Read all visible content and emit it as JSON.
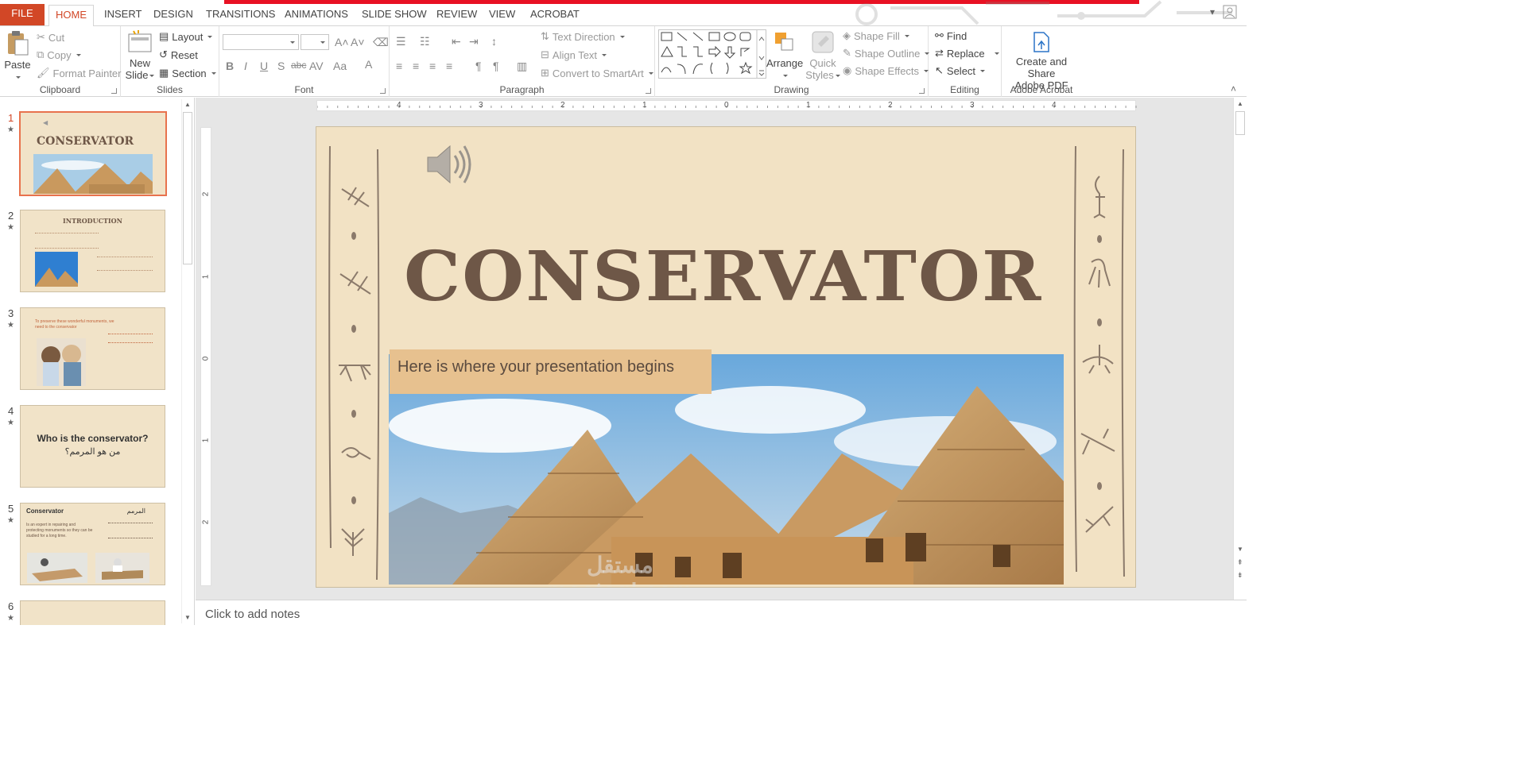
{
  "tabs": {
    "file": "FILE",
    "items": [
      "HOME",
      "INSERT",
      "DESIGN",
      "TRANSITIONS",
      "ANIMATIONS",
      "SLIDE SHOW",
      "REVIEW",
      "VIEW",
      "ACROBAT"
    ],
    "active": "HOME"
  },
  "ribbon": {
    "clipboard": {
      "label": "Clipboard",
      "paste": "Paste",
      "cut": "Cut",
      "copy": "Copy",
      "format_painter": "Format Painter"
    },
    "slides": {
      "label": "Slides",
      "new_slide_1": "New",
      "new_slide_2": "Slide",
      "layout": "Layout",
      "reset": "Reset",
      "section": "Section"
    },
    "font": {
      "label": "Font"
    },
    "paragraph": {
      "label": "Paragraph",
      "text_direction": "Text Direction",
      "align_text": "Align Text",
      "convert_smartart": "Convert to SmartArt"
    },
    "drawing": {
      "label": "Drawing",
      "arrange": "Arrange",
      "quick_styles_1": "Quick",
      "quick_styles_2": "Styles",
      "shape_fill": "Shape Fill",
      "shape_outline": "Shape Outline",
      "shape_effects": "Shape Effects"
    },
    "editing": {
      "label": "Editing",
      "find": "Find",
      "replace": "Replace",
      "select": "Select"
    },
    "acrobat": {
      "label": "Adobe Acrobat",
      "create_1": "Create and Share",
      "create_2": "Adobe PDF"
    }
  },
  "thumbnails": [
    {
      "num": "1",
      "title": "CONSERVATOR",
      "sub": "Here is where your presentation begins"
    },
    {
      "num": "2",
      "title": "INTRODUCTION"
    },
    {
      "num": "3",
      "title": "To preserve these wonderful monuments, we need to the conservator"
    },
    {
      "num": "4",
      "title": "Who is the conservator?",
      "arabic": "من هو المرمم؟"
    },
    {
      "num": "5",
      "title": "Conservator",
      "arabic": "المرمم",
      "body": "Is an expert in repairing and protecting monuments so they can be studied for a long time."
    },
    {
      "num": "6"
    }
  ],
  "ruler": {
    "h": [
      "4",
      "3",
      "2",
      "1",
      "0",
      "1",
      "2",
      "3",
      "4"
    ],
    "v": [
      "2",
      "1",
      "0",
      "1",
      "2"
    ]
  },
  "slide": {
    "title": "CONSERVATOR",
    "subtitle": "Here is where your presentation begins",
    "watermark_1": "مستقل",
    "watermark_2": "mostaql.com"
  },
  "notes_placeholder": "Click to add notes",
  "colors": {
    "accent": "#d24726",
    "slide_bg": "#f2e2c4",
    "title": "#6e5747",
    "subtitle_bg": "#e7c18f"
  }
}
